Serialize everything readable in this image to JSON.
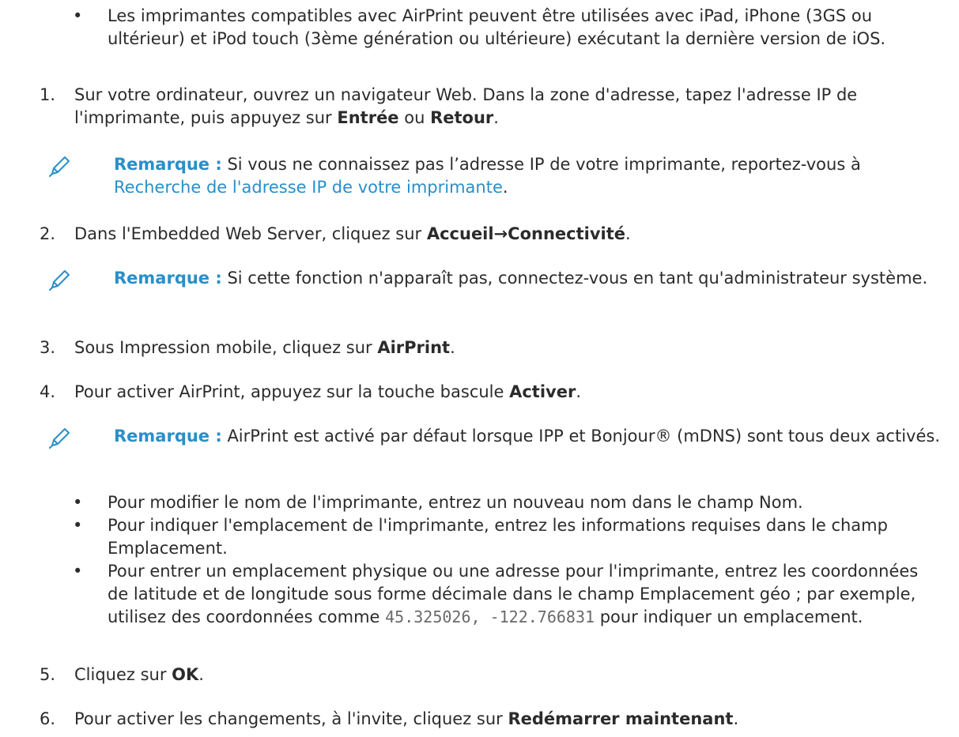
{
  "intro_bullet": "Les imprimantes compatibles avec AirPrint peuvent être utilisées avec iPad, iPhone (3GS ou ultérieur) et iPod touch (3ème génération ou ultérieure) exécutant la dernière version de  iOS.",
  "steps": {
    "s1": {
      "num": "1.",
      "pre": "Sur votre ordinateur, ouvrez un navigateur Web. Dans la zone d'adresse, tapez l'adresse IP de l'imprimante, puis appuyez sur ",
      "b1": "Entrée",
      "mid": " ou ",
      "b2": "Retour",
      "post": "."
    },
    "s2": {
      "num": "2.",
      "pre": "Dans l'Embedded Web Server, cliquez sur ",
      "b1": "Accueil→Connectivité",
      "post": "."
    },
    "s3": {
      "num": "3.",
      "pre": "Sous Impression mobile, cliquez sur ",
      "b1": "AirPrint",
      "post": "."
    },
    "s4": {
      "num": "4.",
      "pre": "Pour activer AirPrint, appuyez sur la touche bascule ",
      "b1": "Activer",
      "post": "."
    },
    "s5": {
      "num": "5.",
      "pre": "Cliquez sur ",
      "b1": "OK",
      "post": "."
    },
    "s6": {
      "num": "6.",
      "pre": "Pour activer les changements, à l'invite, cliquez sur ",
      "b1": "Redémarrer maintenant",
      "post": "."
    }
  },
  "notes": {
    "label": "Remarque :",
    "n1_pre": " Si vous ne connaissez pas l’adresse IP de votre imprimante, reportez-vous à ",
    "n1_link": "Recherche de l'adresse IP de votre imprimante",
    "n1_post": ".",
    "n2": " Si cette fonction n'apparaît pas, connectez-vous en tant qu'administrateur système.",
    "n3": " AirPrint est activé par défaut lorsque IPP et Bonjour® (mDNS) sont tous deux activés."
  },
  "sub_bullets": {
    "b1": "Pour modifier le nom de l'imprimante, entrez un nouveau nom dans le champ Nom.",
    "b2": "Pour indiquer l'emplacement de l'imprimante, entrez les informations requises dans le champ Emplacement.",
    "b3_pre": "Pour entrer un emplacement physique ou une adresse pour l'imprimante, entrez les coordonnées de latitude et de longitude sous forme décimale dans le champ Emplacement géo ; par exemple, utilisez des coordonnées comme ",
    "b3_code": "45.325026, -122.766831",
    "b3_post": " pour indiquer un emplacement."
  },
  "bullet_glyph": "•",
  "colors": {
    "accent": "#2a8fc9",
    "text": "#2b2b2b",
    "code": "#6a6a6a"
  },
  "icons": {
    "note": "pencil-icon"
  }
}
